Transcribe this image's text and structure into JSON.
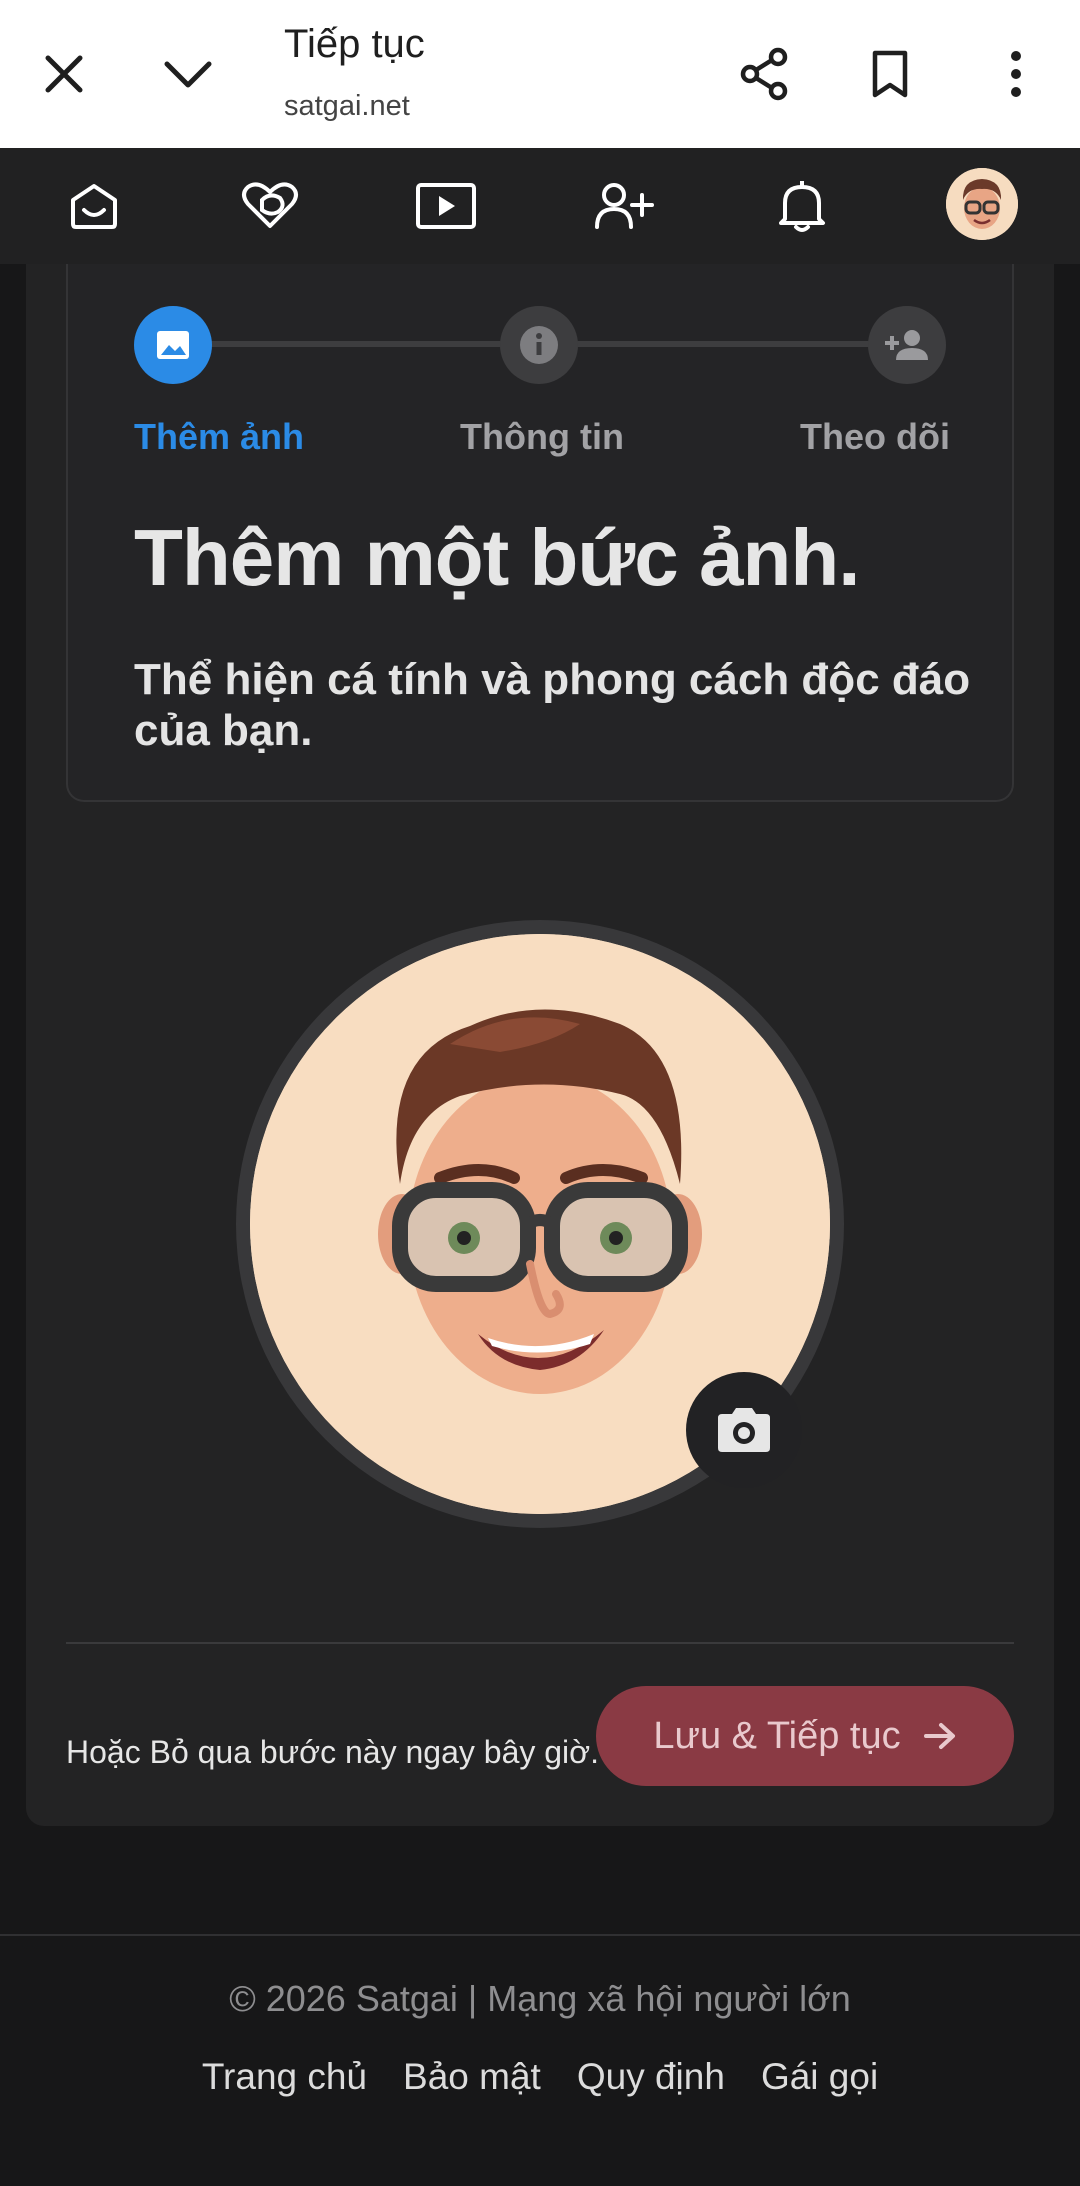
{
  "browser": {
    "title": "Tiếp tục",
    "url": "satgai.net"
  },
  "nav": {
    "icons": [
      "home-icon",
      "heart-chat-icon",
      "video-icon",
      "add-friend-icon",
      "bell-icon",
      "avatar"
    ]
  },
  "steps": {
    "items": [
      {
        "label": "Thêm ảnh",
        "icon": "image-icon",
        "active": true
      },
      {
        "label": "Thông tin",
        "icon": "info-icon",
        "active": false
      },
      {
        "label": "Theo dõi",
        "icon": "person-add-icon",
        "active": false
      }
    ]
  },
  "content": {
    "headline": "Thêm một bức ảnh.",
    "subline": "Thể hiện cá tính và phong cách độc đáo của bạn."
  },
  "actions": {
    "skip_text": "Hoặc Bỏ qua bước này ngay bây giờ.",
    "save_label": "Lưu & Tiếp tục"
  },
  "footer": {
    "copyright": "© 2026 Satgai | Mạng xã hội người lớn",
    "links": [
      "Trang chủ",
      "Bảo mật",
      "Quy định",
      "Gái gọi"
    ]
  },
  "colors": {
    "accent": "#2b8be6",
    "save_button": "#8a3a44",
    "background": "#171718"
  }
}
